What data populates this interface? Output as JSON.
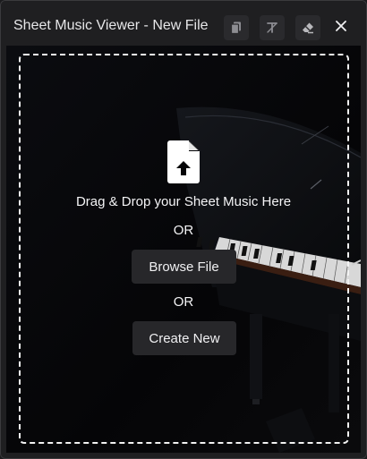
{
  "window": {
    "title": "Sheet Music Viewer - New File"
  },
  "toolbar": {
    "buttons": [
      {
        "icon": "copy-icon"
      },
      {
        "icon": "clear-formatting-icon"
      },
      {
        "icon": "eraser-icon"
      }
    ],
    "close_icon": "close-icon"
  },
  "dropzone": {
    "icon": "file-upload-icon",
    "drop_text": "Drag & Drop your Sheet Music Here",
    "or_1": "OR",
    "browse_label": "Browse File",
    "or_2": "OR",
    "create_label": "Create New"
  },
  "colors": {
    "window_bg": "#1f1f21",
    "content_bg": "#050507",
    "button_bg": "#27272a",
    "text": "#f4f4f6",
    "dashed_border": "#f2f2f2"
  }
}
